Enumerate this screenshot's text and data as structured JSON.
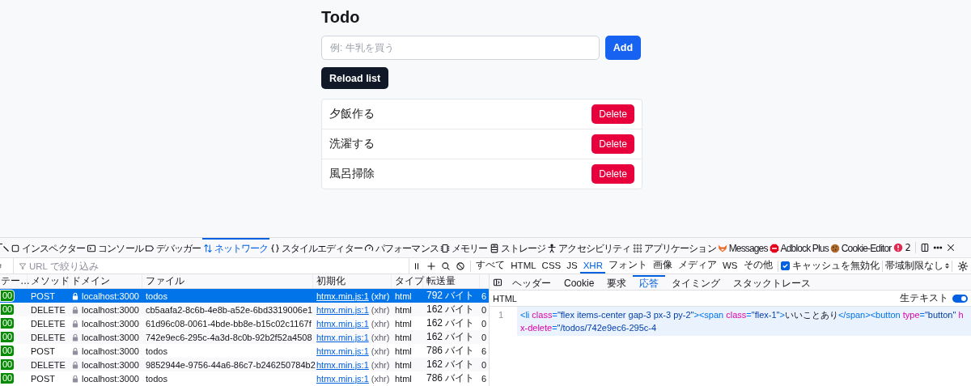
{
  "app": {
    "title": "Todo",
    "new_todo": {
      "placeholder": "例: 牛乳を買う"
    },
    "add_button": "Add",
    "reload_button": "Reload list",
    "todos": [
      {
        "text": "夕飯作る",
        "delete_button": "Delete"
      },
      {
        "text": "洗濯する",
        "delete_button": "Delete"
      },
      {
        "text": "風呂掃除",
        "delete_button": "Delete"
      }
    ]
  },
  "devtools": {
    "tabs": [
      {
        "label": "インスペクター",
        "kind": "inspector",
        "selected": false
      },
      {
        "label": "コンソール",
        "kind": "console",
        "selected": false
      },
      {
        "label": "デバッガー",
        "kind": "debugger",
        "selected": false
      },
      {
        "label": "ネットワーク",
        "kind": "network",
        "selected": true
      },
      {
        "label": "スタイルエディター",
        "kind": "styles",
        "selected": false
      },
      {
        "label": "パフォーマンス",
        "kind": "performance",
        "selected": false
      },
      {
        "label": "メモリー",
        "kind": "memory",
        "selected": false
      },
      {
        "label": "ストレージ",
        "kind": "storage",
        "selected": false
      },
      {
        "label": "アクセシビリティ",
        "kind": "accessibility",
        "selected": false
      },
      {
        "label": "アプリケーション",
        "kind": "application",
        "selected": false
      },
      {
        "label": "Messages",
        "kind": "extension1",
        "selected": false
      },
      {
        "label": "Adblock Plus",
        "kind": "extension2",
        "selected": false
      },
      {
        "label": "Cookie-Editor",
        "kind": "extension3",
        "selected": false
      }
    ],
    "error_count": "2",
    "filter": {
      "placeholder": "URL で絞り込み"
    },
    "type_filters": [
      {
        "label": "すべて",
        "selected": false
      },
      {
        "label": "HTML",
        "selected": false
      },
      {
        "label": "CSS",
        "selected": false
      },
      {
        "label": "JS",
        "selected": false
      },
      {
        "label": "XHR",
        "selected": true
      },
      {
        "label": "フォント",
        "selected": false
      },
      {
        "label": "画像",
        "selected": false
      },
      {
        "label": "メディア",
        "selected": false
      },
      {
        "label": "WS",
        "selected": false
      },
      {
        "label": "その他",
        "selected": false
      }
    ],
    "disable_cache": {
      "label": "キャッシュを無効化",
      "checked": true
    },
    "throttling": "帯域制限なし",
    "request_table": {
      "columns": [
        "テー…",
        "メソッド",
        "ドメイン",
        "ファイル",
        "初期化",
        "タイプ",
        "転送量"
      ],
      "rows": [
        {
          "status": "00",
          "method": "POST",
          "domain": "localhost:3000",
          "file": "todos",
          "initiator": "htmx.min.js:1",
          "cause": "(xhr)",
          "type": "html",
          "transferred": "792 バイト",
          "column_8": "6",
          "selected": true
        },
        {
          "status": "00",
          "method": "DELETE",
          "domain": "localhost:3000",
          "file": "cb5aafa2-8c6b-4e8b-a52e-6bd3319006e1",
          "initiator": "htmx.min.js:1",
          "cause": "(xhr)",
          "type": "html",
          "transferred": "162 バイト",
          "column_8": "0",
          "selected": false
        },
        {
          "status": "00",
          "method": "DELETE",
          "domain": "localhost:3000",
          "file": "61d96c08-0061-4bde-bb8e-b15c02c1167f",
          "initiator": "htmx.min.js:1",
          "cause": "(xhr)",
          "type": "html",
          "transferred": "162 バイト",
          "column_8": "0",
          "selected": false
        },
        {
          "status": "00",
          "method": "DELETE",
          "domain": "localhost:3000",
          "file": "742e9ec6-295c-4a3d-8c0b-92b2f52a4508",
          "initiator": "htmx.min.js:1",
          "cause": "(xhr)",
          "type": "html",
          "transferred": "162 バイト",
          "column_8": "0",
          "selected": false
        },
        {
          "status": "00",
          "method": "POST",
          "domain": "localhost:3000",
          "file": "todos",
          "initiator": "htmx.min.js:1",
          "cause": "(xhr)",
          "type": "html",
          "transferred": "786 バイト",
          "column_8": "6",
          "selected": false
        },
        {
          "status": "00",
          "method": "DELETE",
          "domain": "localhost:3000",
          "file": "9852944e-9756-44a6-86c7-b246250784b2",
          "initiator": "htmx.min.js:1",
          "cause": "(xhr)",
          "type": "html",
          "transferred": "162 バイト",
          "column_8": "0",
          "selected": false
        },
        {
          "status": "00",
          "method": "POST",
          "domain": "localhost:3000",
          "file": "todos",
          "initiator": "htmx.min.js:1",
          "cause": "(xhr)",
          "type": "html",
          "transferred": "786 バイト",
          "column_8": "6",
          "selected": false
        }
      ]
    },
    "detail_tabs": [
      {
        "label": "ヘッダー",
        "selected": false
      },
      {
        "label": "Cookie",
        "selected": false
      },
      {
        "label": "要求",
        "selected": false
      },
      {
        "label": "応答",
        "selected": true
      },
      {
        "label": "タイミング",
        "selected": false
      },
      {
        "label": "スタックトレース",
        "selected": false
      }
    ],
    "response": {
      "format": "HTML",
      "raw_label": "生テキスト",
      "raw_on": true,
      "line_number": "1",
      "code": [
        {
          "kind": "tag",
          "text": "<li"
        },
        {
          "kind": "attr",
          "text": " class"
        },
        {
          "kind": "tag",
          "text": "="
        },
        {
          "kind": "value",
          "text": "\"flex items-center gap-3 px-3 py-2\""
        },
        {
          "kind": "tag",
          "text": "><span"
        },
        {
          "kind": "attr",
          "text": " class"
        },
        {
          "kind": "tag",
          "text": "="
        },
        {
          "kind": "value",
          "text": "\"flex-1\""
        },
        {
          "kind": "tag",
          "text": ">"
        },
        {
          "kind": "text",
          "text": "いいことあり"
        },
        {
          "kind": "tag",
          "text": "</span><button"
        },
        {
          "kind": "attr",
          "text": " type"
        },
        {
          "kind": "tag",
          "text": "="
        },
        {
          "kind": "value",
          "text": "\"button\""
        },
        {
          "kind": "attr",
          "text": " hx-delete"
        },
        {
          "kind": "tag",
          "text": "="
        },
        {
          "kind": "value",
          "text": "\"/todos/742e9ec6-295c-4"
        }
      ]
    }
  }
}
